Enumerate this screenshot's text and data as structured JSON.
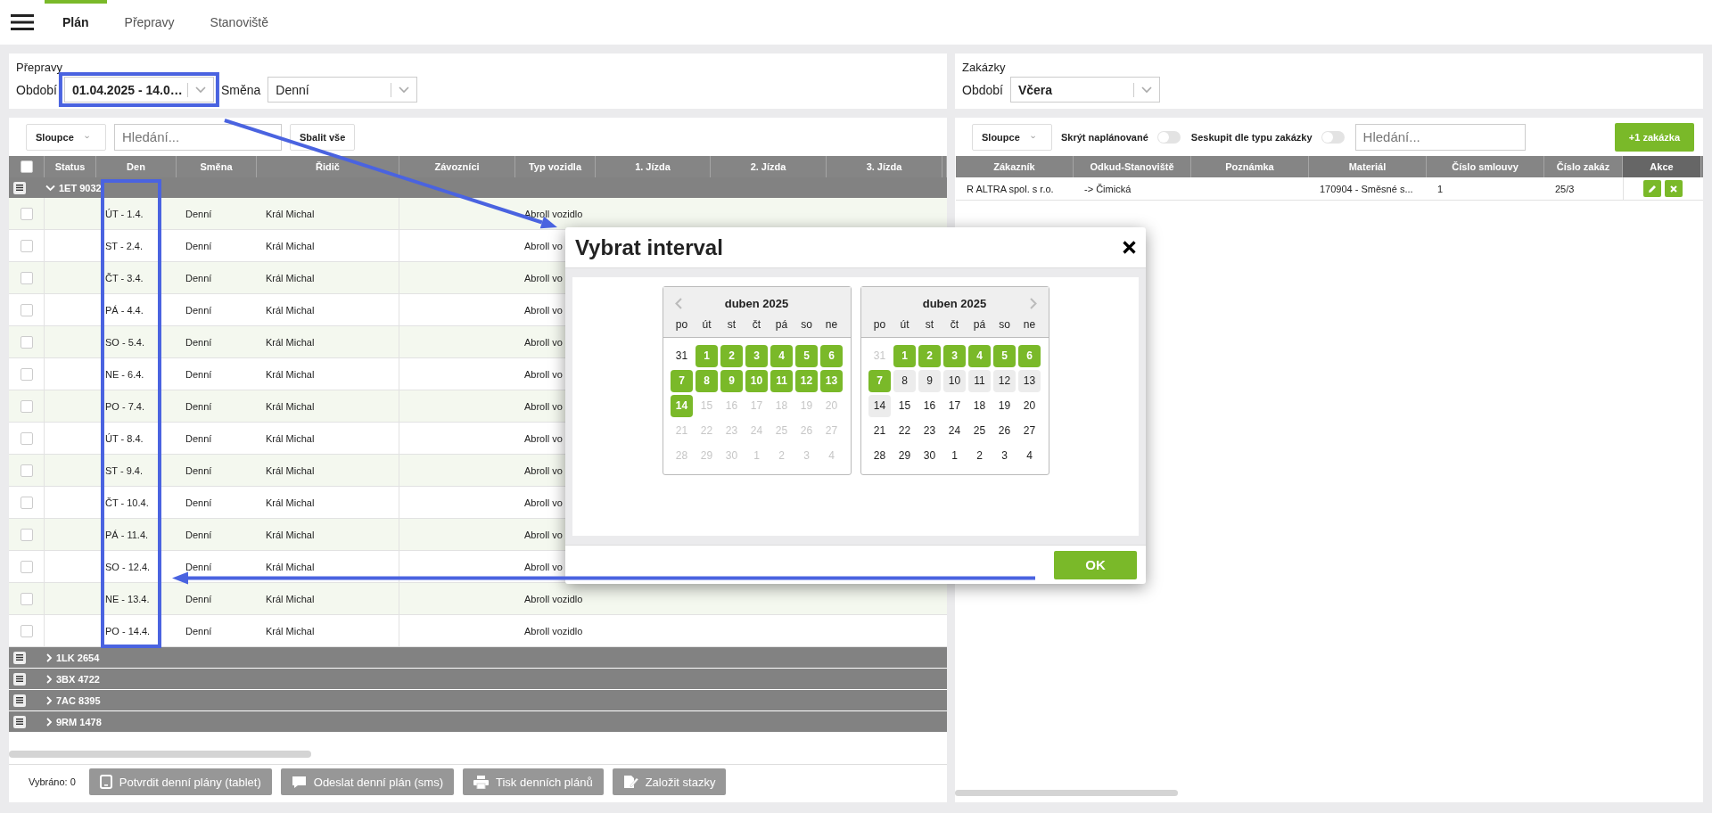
{
  "nav": {
    "tabs": [
      {
        "label": "Plán",
        "selected": true
      },
      {
        "label": "Přepravy",
        "selected": false
      },
      {
        "label": "Stanoviště",
        "selected": false
      }
    ]
  },
  "transports_filter": {
    "title": "Přepravy",
    "fields": [
      {
        "label": "Období",
        "value": "01.04.2025 - 14.0…",
        "bold": true
      },
      {
        "label": "Směna",
        "value": "Denní",
        "bold": false
      }
    ]
  },
  "transports": {
    "toolbar": {
      "columns_button": "Sloupce",
      "search_placeholder": "Hledání...",
      "collapse_button": "Sbalit vše"
    },
    "header_checkbox": {
      "checked": false
    },
    "columns": [
      "Status",
      "Den",
      "Směna",
      "Řidič",
      "Závozníci",
      "Typ vozidla",
      "1. Jízda",
      "2. Jízda",
      "3. Jízda"
    ],
    "groups": [
      {
        "label": "1ET 9032",
        "expanded": true,
        "rows": [
          {
            "checked": false,
            "day": "ÚT - 1.4.",
            "shift": "Denní",
            "driver": "Král Michal",
            "vehicle_type": "Abroll vozidlo"
          },
          {
            "checked": false,
            "day": "ST - 2.4.",
            "shift": "Denní",
            "driver": "Král Michal",
            "vehicle_type": "Abroll vo"
          },
          {
            "checked": false,
            "day": "ČT - 3.4.",
            "shift": "Denní",
            "driver": "Král Michal",
            "vehicle_type": "Abroll vo"
          },
          {
            "checked": false,
            "day": "PÁ - 4.4.",
            "shift": "Denní",
            "driver": "Král Michal",
            "vehicle_type": "Abroll vo"
          },
          {
            "checked": false,
            "day": "SO - 5.4.",
            "shift": "Denní",
            "driver": "Král Michal",
            "vehicle_type": "Abroll vo"
          },
          {
            "checked": false,
            "day": "NE - 6.4.",
            "shift": "Denní",
            "driver": "Král Michal",
            "vehicle_type": "Abroll vo"
          },
          {
            "checked": false,
            "day": "PO - 7.4.",
            "shift": "Denní",
            "driver": "Král Michal",
            "vehicle_type": "Abroll vo"
          },
          {
            "checked": false,
            "day": "ÚT - 8.4.",
            "shift": "Denní",
            "driver": "Král Michal",
            "vehicle_type": "Abroll vo"
          },
          {
            "checked": false,
            "day": "ST - 9.4.",
            "shift": "Denní",
            "driver": "Král Michal",
            "vehicle_type": "Abroll vo"
          },
          {
            "checked": false,
            "day": "ČT - 10.4.",
            "shift": "Denní",
            "driver": "Král Michal",
            "vehicle_type": "Abroll vo"
          },
          {
            "checked": false,
            "day": "PÁ - 11.4.",
            "shift": "Denní",
            "driver": "Král Michal",
            "vehicle_type": "Abroll vo"
          },
          {
            "checked": false,
            "day": "SO - 12.4.",
            "shift": "Denní",
            "driver": "Král Michal",
            "vehicle_type": "Abroll vo"
          },
          {
            "checked": false,
            "day": "NE - 13.4.",
            "shift": "Denní",
            "driver": "Král Michal",
            "vehicle_type": "Abroll vozidlo"
          },
          {
            "checked": false,
            "day": "PO - 14.4.",
            "shift": "Denní",
            "driver": "Král Michal",
            "vehicle_type": "Abroll vozidlo"
          }
        ]
      },
      {
        "label": "1LK 2654",
        "expanded": false
      },
      {
        "label": "3BX 4722",
        "expanded": false
      },
      {
        "label": "7AC 8395",
        "expanded": false
      },
      {
        "label": "9RM 1478",
        "expanded": false
      }
    ],
    "footer": {
      "selected_count": "Vybráno: 0",
      "buttons": [
        {
          "label": "Potvrdit denní plány (tablet)",
          "disabled": true
        },
        {
          "label": "Odeslat denní plán (sms)",
          "disabled": true
        },
        {
          "label": "Tisk denních plánů",
          "disabled": true
        },
        {
          "label": "Založit stazky",
          "disabled": true
        }
      ]
    }
  },
  "orders_filter": {
    "title": "Zakázky",
    "fields": [
      {
        "label": "Období",
        "value": "Včera",
        "bold": true
      }
    ]
  },
  "orders": {
    "toolbar": {
      "columns_button": "Sloupce",
      "toggles": [
        {
          "label": "Skrýt naplánované",
          "on": false
        },
        {
          "label": "Seskupit dle typu zakázky",
          "on": false
        }
      ],
      "search_placeholder": "Hledání...",
      "add_button": "+1 zakázka"
    },
    "columns": [
      "Zákazník",
      "Odkud-Stanoviště",
      "Poznámka",
      "Materiál",
      "Číslo smlouvy",
      "Číslo zakáz",
      "Akce"
    ],
    "rows": [
      {
        "customer": "R ALTRA spol. s r.o.",
        "from": "-> Čimická",
        "material": "170904 - Směsné s...",
        "contract_no": "1",
        "order_no": "25/3"
      }
    ]
  },
  "dialog": {
    "title": "Vybrat interval",
    "ok_button": "OK",
    "calendars": [
      {
        "month": "duben 2025",
        "weekdays": [
          "po",
          "út",
          "st",
          "čt",
          "pá",
          "so",
          "ne"
        ],
        "weeks": [
          [
            {
              "day": "31",
              "kind": "normal"
            },
            {
              "day": "1",
              "kind": "selected"
            },
            {
              "day": "2",
              "kind": "selected"
            },
            {
              "day": "3",
              "kind": "selected"
            },
            {
              "day": "4",
              "kind": "selected"
            },
            {
              "day": "5",
              "kind": "selected"
            },
            {
              "day": "6",
              "kind": "selected"
            }
          ],
          [
            {
              "day": "7",
              "kind": "selected"
            },
            {
              "day": "8",
              "kind": "selected"
            },
            {
              "day": "9",
              "kind": "selected"
            },
            {
              "day": "10",
              "kind": "selected"
            },
            {
              "day": "11",
              "kind": "selected"
            },
            {
              "day": "12",
              "kind": "selected"
            },
            {
              "day": "13",
              "kind": "selected"
            }
          ],
          [
            {
              "day": "14",
              "kind": "selected"
            },
            {
              "day": "15",
              "kind": "muted"
            },
            {
              "day": "16",
              "kind": "muted"
            },
            {
              "day": "17",
              "kind": "muted"
            },
            {
              "day": "18",
              "kind": "muted"
            },
            {
              "day": "19",
              "kind": "muted"
            },
            {
              "day": "20",
              "kind": "muted"
            }
          ],
          [
            {
              "day": "21",
              "kind": "muted"
            },
            {
              "day": "22",
              "kind": "muted"
            },
            {
              "day": "23",
              "kind": "muted"
            },
            {
              "day": "24",
              "kind": "muted"
            },
            {
              "day": "25",
              "kind": "muted"
            },
            {
              "day": "26",
              "kind": "muted"
            },
            {
              "day": "27",
              "kind": "muted"
            }
          ],
          [
            {
              "day": "28",
              "kind": "muted"
            },
            {
              "day": "29",
              "kind": "muted"
            },
            {
              "day": "30",
              "kind": "muted"
            },
            {
              "day": "1",
              "kind": "muted"
            },
            {
              "day": "2",
              "kind": "muted"
            },
            {
              "day": "3",
              "kind": "muted"
            },
            {
              "day": "4",
              "kind": "muted"
            }
          ]
        ]
      },
      {
        "month": "duben 2025",
        "weekdays": [
          "po",
          "út",
          "st",
          "čt",
          "pá",
          "so",
          "ne"
        ],
        "weeks": [
          [
            {
              "day": "31",
              "kind": "muted"
            },
            {
              "day": "1",
              "kind": "selected"
            },
            {
              "day": "2",
              "kind": "selected"
            },
            {
              "day": "3",
              "kind": "selected"
            },
            {
              "day": "4",
              "kind": "selected"
            },
            {
              "day": "5",
              "kind": "selected"
            },
            {
              "day": "6",
              "kind": "selected"
            }
          ],
          [
            {
              "day": "7",
              "kind": "selected"
            },
            {
              "day": "8",
              "kind": "range"
            },
            {
              "day": "9",
              "kind": "range"
            },
            {
              "day": "10",
              "kind": "range"
            },
            {
              "day": "11",
              "kind": "range"
            },
            {
              "day": "12",
              "kind": "range"
            },
            {
              "day": "13",
              "kind": "range"
            }
          ],
          [
            {
              "day": "14",
              "kind": "range"
            },
            {
              "day": "15",
              "kind": "normal"
            },
            {
              "day": "16",
              "kind": "normal"
            },
            {
              "day": "17",
              "kind": "normal"
            },
            {
              "day": "18",
              "kind": "normal"
            },
            {
              "day": "19",
              "kind": "normal"
            },
            {
              "day": "20",
              "kind": "normal"
            }
          ],
          [
            {
              "day": "21",
              "kind": "normal"
            },
            {
              "day": "22",
              "kind": "normal"
            },
            {
              "day": "23",
              "kind": "normal"
            },
            {
              "day": "24",
              "kind": "normal"
            },
            {
              "day": "25",
              "kind": "normal"
            },
            {
              "day": "26",
              "kind": "normal"
            },
            {
              "day": "27",
              "kind": "normal"
            }
          ],
          [
            {
              "day": "28",
              "kind": "normal"
            },
            {
              "day": "29",
              "kind": "normal"
            },
            {
              "day": "30",
              "kind": "normal"
            },
            {
              "day": "1",
              "kind": "normal"
            },
            {
              "day": "2",
              "kind": "normal"
            },
            {
              "day": "3",
              "kind": "normal"
            },
            {
              "day": "4",
              "kind": "normal"
            }
          ]
        ]
      }
    ]
  }
}
